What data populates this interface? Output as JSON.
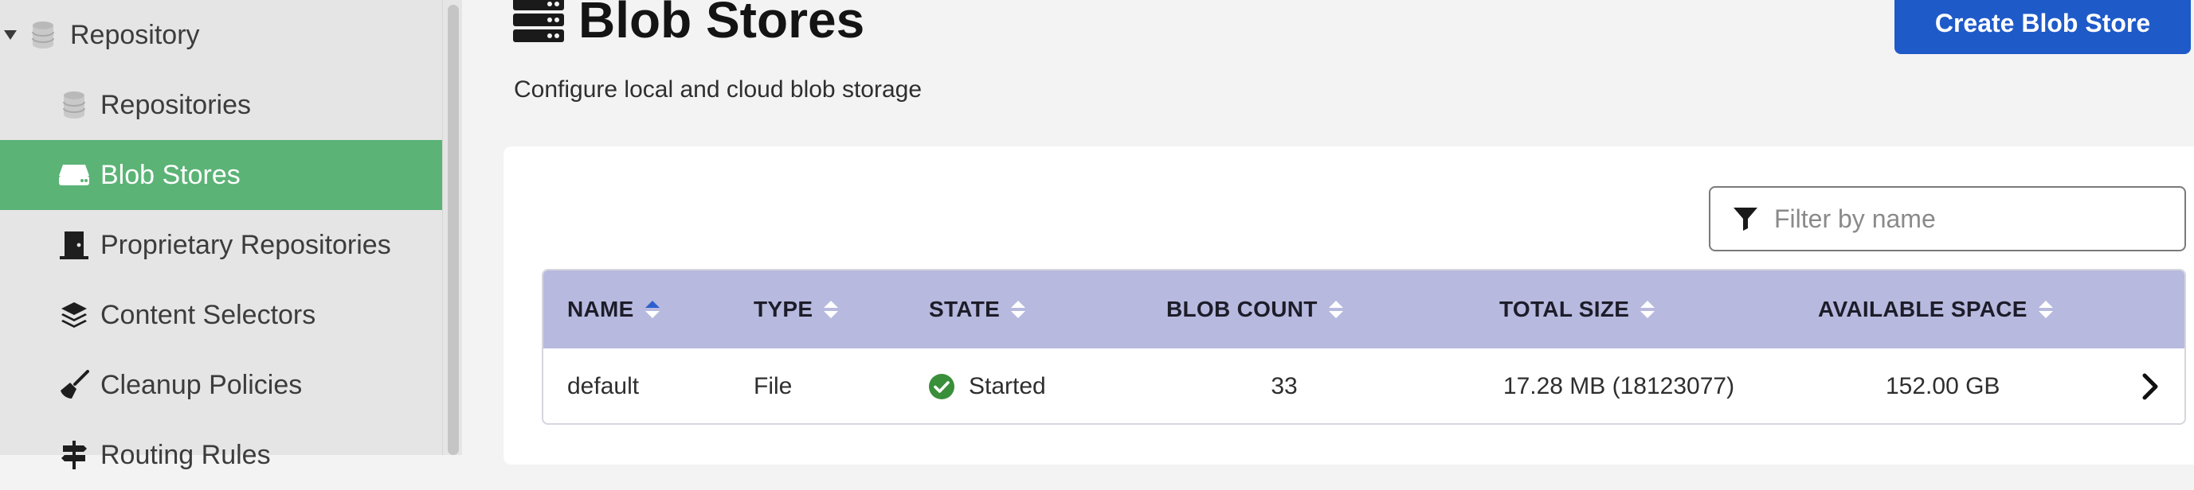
{
  "sidebar": {
    "items": [
      {
        "label": "Repository",
        "icon": "database-icon"
      },
      {
        "label": "Repositories",
        "icon": "database-icon"
      },
      {
        "label": "Blob Stores",
        "icon": "hard-drive-icon"
      },
      {
        "label": "Proprietary Repositories",
        "icon": "door-icon"
      },
      {
        "label": "Content Selectors",
        "icon": "layers-icon"
      },
      {
        "label": "Cleanup Policies",
        "icon": "broom-icon"
      },
      {
        "label": "Routing Rules",
        "icon": "signpost-icon"
      }
    ],
    "active_index": 2
  },
  "header": {
    "title": "Blob Stores",
    "subtitle": "Configure local and cloud blob storage",
    "create_label": "Create Blob Store"
  },
  "filter": {
    "placeholder": "Filter by name"
  },
  "table": {
    "columns": [
      "NAME",
      "TYPE",
      "STATE",
      "BLOB COUNT",
      "TOTAL SIZE",
      "AVAILABLE SPACE"
    ],
    "sorted_column": "NAME",
    "rows": [
      {
        "name": "default",
        "type": "File",
        "state": "Started",
        "blob_count": "33",
        "total_size": "17.28 MB (18123077)",
        "available_space": "152.00 GB"
      }
    ]
  },
  "colors": {
    "active_nav": "#5bb376",
    "primary_button": "#1f5ac9",
    "table_header": "#b7b9de",
    "status_ok": "#3a8f3a"
  }
}
